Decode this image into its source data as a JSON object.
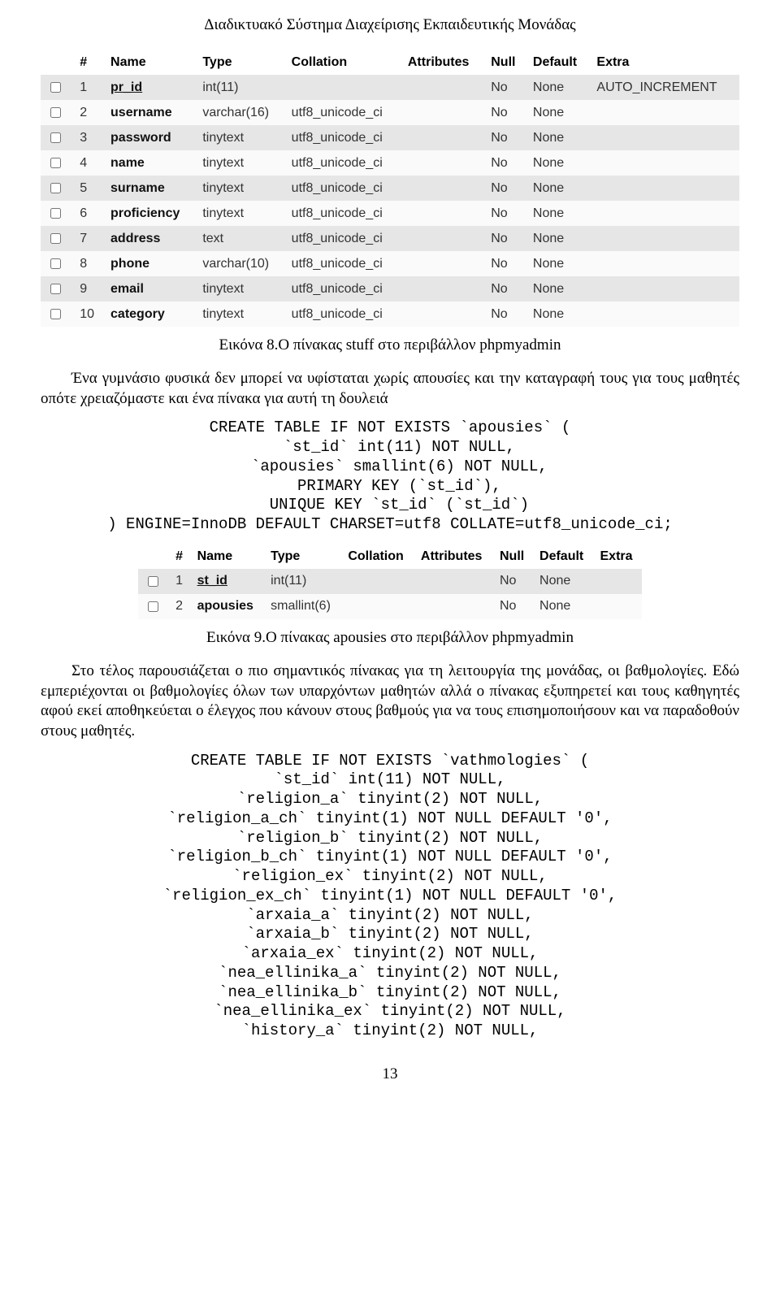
{
  "header": {
    "title": "Διαδικτυακό Σύστημα Διαχείρισης Εκπαιδευτικής Μονάδας"
  },
  "table1": {
    "headers": [
      "#",
      "Name",
      "Type",
      "Collation",
      "Attributes",
      "Null",
      "Default",
      "Extra"
    ],
    "rows": [
      {
        "num": "1",
        "name": "pr_id",
        "underline": true,
        "type": "int(11)",
        "collation": "",
        "attrs": "",
        "null": "No",
        "default": "None",
        "extra": "AUTO_INCREMENT"
      },
      {
        "num": "2",
        "name": "username",
        "underline": false,
        "type": "varchar(16)",
        "collation": "utf8_unicode_ci",
        "attrs": "",
        "null": "No",
        "default": "None",
        "extra": ""
      },
      {
        "num": "3",
        "name": "password",
        "underline": false,
        "type": "tinytext",
        "collation": "utf8_unicode_ci",
        "attrs": "",
        "null": "No",
        "default": "None",
        "extra": ""
      },
      {
        "num": "4",
        "name": "name",
        "underline": false,
        "type": "tinytext",
        "collation": "utf8_unicode_ci",
        "attrs": "",
        "null": "No",
        "default": "None",
        "extra": ""
      },
      {
        "num": "5",
        "name": "surname",
        "underline": false,
        "type": "tinytext",
        "collation": "utf8_unicode_ci",
        "attrs": "",
        "null": "No",
        "default": "None",
        "extra": ""
      },
      {
        "num": "6",
        "name": "proficiency",
        "underline": false,
        "type": "tinytext",
        "collation": "utf8_unicode_ci",
        "attrs": "",
        "null": "No",
        "default": "None",
        "extra": ""
      },
      {
        "num": "7",
        "name": "address",
        "underline": false,
        "type": "text",
        "collation": "utf8_unicode_ci",
        "attrs": "",
        "null": "No",
        "default": "None",
        "extra": ""
      },
      {
        "num": "8",
        "name": "phone",
        "underline": false,
        "type": "varchar(10)",
        "collation": "utf8_unicode_ci",
        "attrs": "",
        "null": "No",
        "default": "None",
        "extra": ""
      },
      {
        "num": "9",
        "name": "email",
        "underline": false,
        "type": "tinytext",
        "collation": "utf8_unicode_ci",
        "attrs": "",
        "null": "No",
        "default": "None",
        "extra": ""
      },
      {
        "num": "10",
        "name": "category",
        "underline": false,
        "type": "tinytext",
        "collation": "utf8_unicode_ci",
        "attrs": "",
        "null": "No",
        "default": "None",
        "extra": ""
      }
    ]
  },
  "caption1": "Εικόνα 8.Ο πίνακας stuff στο περιβάλλον phpmyadmin",
  "para1": "Ένα γυμνάσιο φυσικά δεν μπορεί να υφίσταται χωρίς απουσίες και την καταγραφή τους για τους μαθητές οπότε χρειαζόμαστε και ένα πίνακα για αυτή τη δουλειά",
  "code1": "CREATE TABLE IF NOT EXISTS `apousies` (\n  `st_id` int(11) NOT NULL,\n  `apousies` smallint(6) NOT NULL,\n  PRIMARY KEY (`st_id`),\n  UNIQUE KEY `st_id` (`st_id`)\n) ENGINE=InnoDB DEFAULT CHARSET=utf8 COLLATE=utf8_unicode_ci;",
  "table2": {
    "headers": [
      "#",
      "Name",
      "Type",
      "Collation",
      "Attributes",
      "Null",
      "Default",
      "Extra"
    ],
    "rows": [
      {
        "num": "1",
        "name": "st_id",
        "underline": true,
        "type": "int(11)",
        "collation": "",
        "attrs": "",
        "null": "No",
        "default": "None",
        "extra": ""
      },
      {
        "num": "2",
        "name": "apousies",
        "underline": false,
        "type": "smallint(6)",
        "collation": "",
        "attrs": "",
        "null": "No",
        "default": "None",
        "extra": ""
      }
    ]
  },
  "caption2": "Εικόνα 9.Ο πίνακας apousies στο περιβάλλον phpmyadmin",
  "para2": "Στο τέλος παρουσιάζεται ο πιο σημαντικός πίνακας για τη λειτουργία της μονάδας, οι βαθμολογίες. Εδώ εμπεριέχονται οι βαθμολογίες όλων των υπαρχόντων μαθητών αλλά ο πίνακας εξυπηρετεί και τους καθηγητές αφού εκεί αποθηκεύεται ο έλεγχος που κάνουν στους βαθμούς για να τους επισημοποιήσουν και να παραδοθούν στους μαθητές.",
  "code2": "CREATE TABLE IF NOT EXISTS `vathmologies` (\n`st_id` int(11) NOT NULL,\n`religion_a` tinyint(2) NOT NULL,\n`religion_a_ch` tinyint(1) NOT NULL DEFAULT '0',\n`religion_b` tinyint(2) NOT NULL,\n`religion_b_ch` tinyint(1) NOT NULL DEFAULT '0',\n`religion_ex` tinyint(2) NOT NULL,\n`religion_ex_ch` tinyint(1) NOT NULL DEFAULT '0',\n`arxaia_a` tinyint(2) NOT NULL,\n`arxaia_b` tinyint(2) NOT NULL,\n`arxaia_ex` tinyint(2) NOT NULL,\n`nea_ellinika_a` tinyint(2) NOT NULL,\n`nea_ellinika_b` tinyint(2) NOT NULL,\n`nea_ellinika_ex` tinyint(2) NOT NULL,\n`history_a` tinyint(2) NOT NULL,",
  "pageNumber": "13"
}
